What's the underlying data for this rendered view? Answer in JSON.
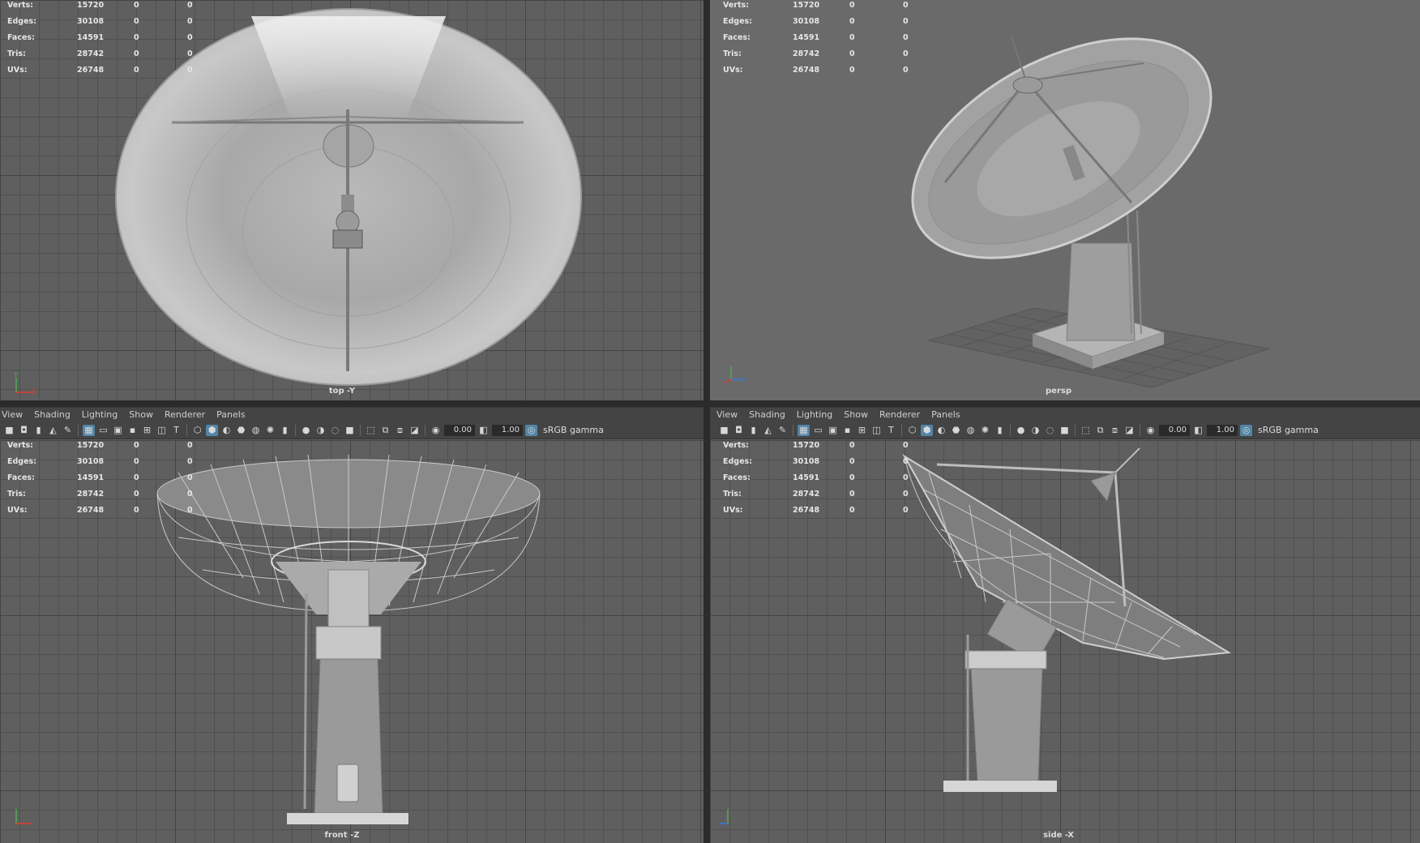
{
  "menu": [
    "View",
    "Shading",
    "Lighting",
    "Show",
    "Renderer",
    "Panels"
  ],
  "toolbar": {
    "exposure": "0.00",
    "gamma_value": "1.00",
    "color_space": "sRGB gamma"
  },
  "hud": {
    "labels": [
      "Verts:",
      "Edges:",
      "Faces:",
      "Tris:",
      "UVs:"
    ],
    "values": [
      "15720",
      "30108",
      "14591",
      "28742",
      "26748"
    ],
    "sel": [
      "0",
      "0",
      "0",
      "0",
      "0"
    ],
    "comp": [
      "0",
      "0",
      "0",
      "0",
      "0"
    ]
  },
  "viewports": {
    "top": {
      "label": "top -Y"
    },
    "persp": {
      "label": "persp"
    },
    "front": {
      "label": "front -Z"
    },
    "side": {
      "label": "side -X"
    }
  },
  "colors": {
    "accent": "#5285a6",
    "viewport_bg": "#5f5f5f",
    "menubar": "#444444"
  }
}
